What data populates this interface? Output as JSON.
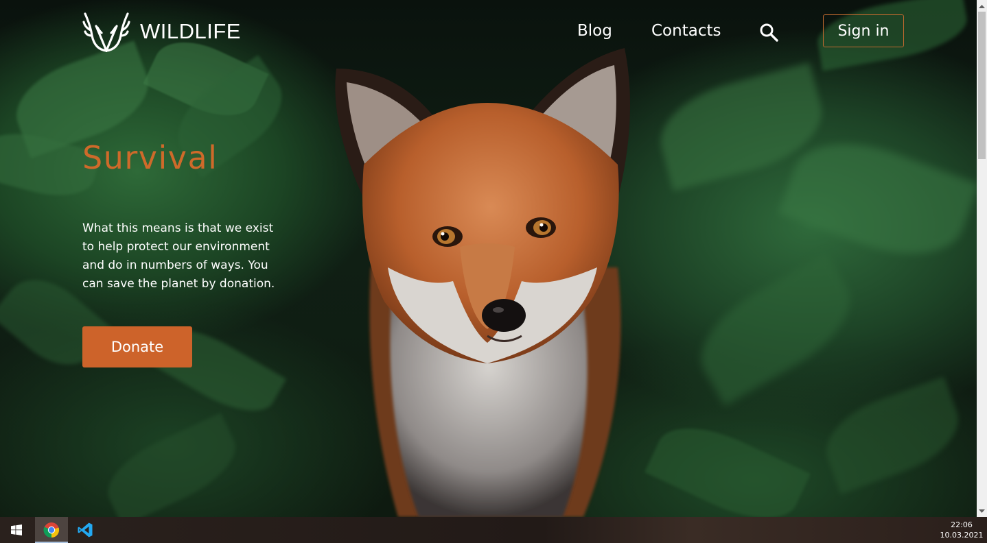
{
  "brand": {
    "name": "WILDLIFE",
    "logo_icon": "antlers-icon"
  },
  "nav": {
    "links": [
      {
        "label": "Blog"
      },
      {
        "label": "Contacts"
      }
    ],
    "search_icon": "search-icon",
    "signin_label": "Sign in"
  },
  "hero": {
    "title": "Survival",
    "text": "What this means is that we exist to help protect our environment and do in numbers of ways. You can save the planet by donation.",
    "donate_label": "Donate"
  },
  "taskbar": {
    "apps": [
      {
        "icon": "windows-start-icon"
      },
      {
        "icon": "chrome-icon",
        "active": true
      },
      {
        "icon": "vscode-icon"
      }
    ],
    "time": "22:06",
    "date": "10.03.2021"
  },
  "colors": {
    "accent": "#cd632a",
    "title": "#cf6a2a",
    "signin_border": "#c0692f"
  }
}
